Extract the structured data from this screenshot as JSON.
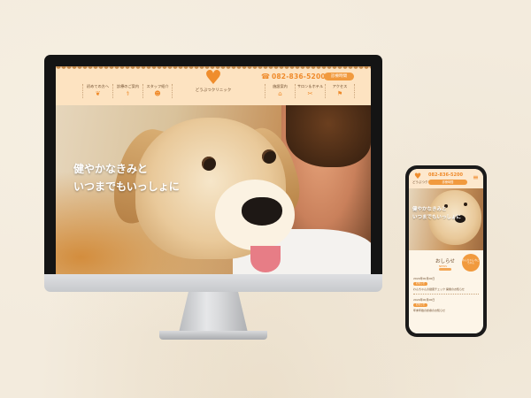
{
  "desktop": {
    "nav_left": [
      {
        "label": "初めての方へ",
        "icon": "beginner-leaf-icon",
        "glyph": "❦"
      },
      {
        "label": "診療のご案内",
        "icon": "stethoscope-icon",
        "glyph": "⚕"
      },
      {
        "label": "スタッフ紹介",
        "icon": "staff-icon",
        "glyph": "☻"
      }
    ],
    "nav_right": [
      {
        "label": "施設案内",
        "icon": "facility-icon",
        "glyph": "⌂"
      },
      {
        "label": "サロン＆ホテル",
        "icon": "salon-icon",
        "glyph": "✂"
      },
      {
        "label": "アクセス",
        "icon": "map-pin-icon",
        "glyph": "⚑"
      }
    ],
    "logo_text": "どうぶつクリニック",
    "phone": "082-836-5200",
    "reserve_label": "診療時間",
    "hero_line1": "健やかなきみと",
    "hero_line2": "いつまでもいっしょに"
  },
  "mobile": {
    "logo_text": "どうぶつクリニック",
    "phone": "082-836-5200",
    "reserve_label": "診療時間",
    "hero_line1": "健やかなきみと",
    "hero_line2": "いつまでもいっしょに",
    "news_title": "おしらせ",
    "news_sub": "NEWS",
    "badge_text": "わんちゃん ねこちゃん",
    "news_items": [
      {
        "date": "2024年00月00日",
        "tag": "お知らせ",
        "text": "わんちゃんの健康チェック 開催のお知らせ"
      },
      {
        "date": "2024年00月00日",
        "tag": "お知らせ",
        "text": "年末年始の診療のお知らせ"
      }
    ]
  },
  "colors": {
    "accent": "#ef8a2a",
    "header_bg": "#fde3c1",
    "text_brown": "#6b4a2b"
  }
}
